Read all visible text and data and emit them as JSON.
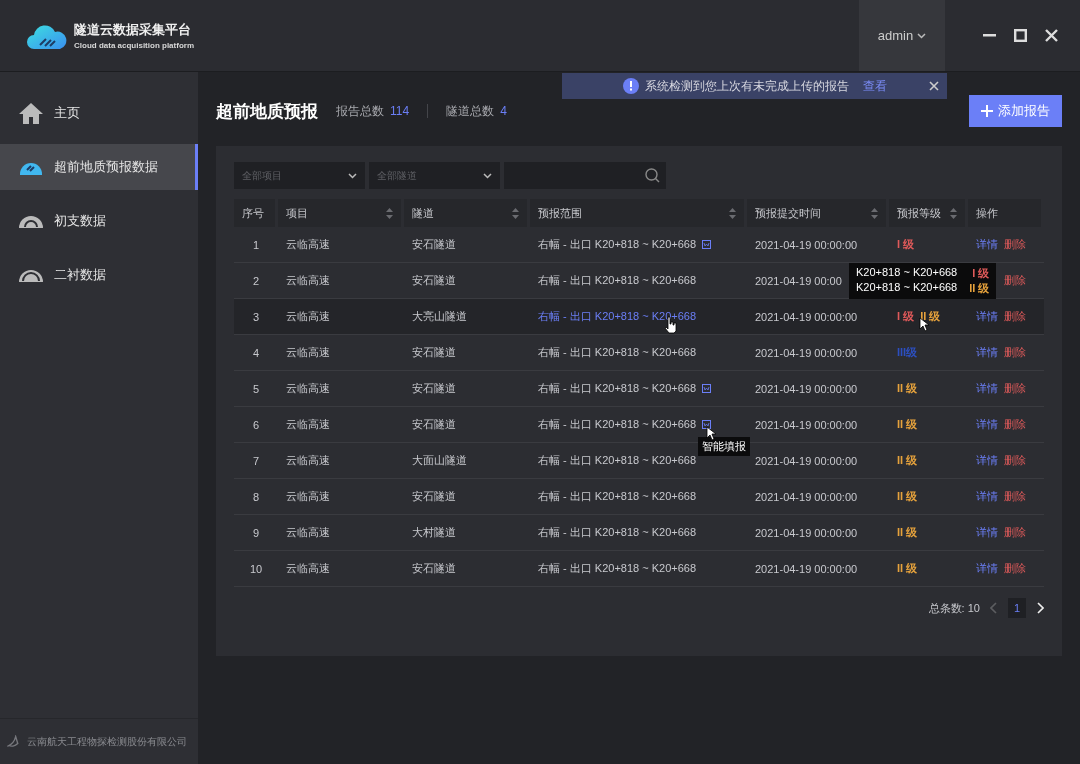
{
  "app": {
    "title": "隧道云数据采集平台",
    "subtitle": "Cloud data acquisition platform"
  },
  "user": {
    "name": "admin"
  },
  "sidebar": {
    "items": [
      {
        "label": "主页",
        "selected": false
      },
      {
        "label": "超前地质预报数据",
        "selected": true
      },
      {
        "label": "初支数据",
        "selected": false
      },
      {
        "label": "二衬数据",
        "selected": false
      }
    ],
    "footer": "云南航天工程物探检测股份有限公司"
  },
  "notice": {
    "text": "系统检测到您上次有未完成上传的报告",
    "link": "查看"
  },
  "page": {
    "title": "超前地质预报",
    "stats": [
      {
        "label": "报告总数",
        "value": "114"
      },
      {
        "label": "隧道总数",
        "value": "4"
      }
    ],
    "add_button": "添加报告"
  },
  "filters": [
    {
      "kind": "select",
      "placeholder": "全部项目"
    },
    {
      "kind": "select",
      "placeholder": "全部隧道"
    },
    {
      "kind": "search"
    }
  ],
  "table": {
    "columns": [
      {
        "label": "序号",
        "sortable": false
      },
      {
        "label": "项目",
        "sortable": true
      },
      {
        "label": "隧道",
        "sortable": true
      },
      {
        "label": "预报范围",
        "sortable": true
      },
      {
        "label": "预报提交时间",
        "sortable": true
      },
      {
        "label": "预报等级",
        "sortable": true
      },
      {
        "label": "操作",
        "sortable": false
      }
    ],
    "rows": [
      {
        "no": "1",
        "project": "云临高速",
        "tunnel": "安石隧道",
        "range": "右幅 - 出口 K20+818 ~ K20+668",
        "attachment": {
          "kind": "word"
        },
        "time": "2021-04-19 00:00:00",
        "levels": [
          {
            "text": "I 级",
            "color": "#e05a5a"
          }
        ],
        "hovered": false,
        "actions": [
          {
            "kind": "detail",
            "label": "详情"
          },
          {
            "kind": "delete",
            "label": "删除"
          }
        ]
      },
      {
        "no": "2",
        "project": "云临高速",
        "tunnel": "安石隧道",
        "range": "右幅 - 出口 K20+818 ~ K20+668",
        "time": "2021-04-19 00:00",
        "hovered": false,
        "actions": [
          {
            "kind": "detail"
          },
          {
            "kind": "delete",
            "label": "删除"
          }
        ]
      },
      {
        "no": "3",
        "project": "云临高速",
        "tunnel": "大亮山隧道",
        "range": "右幅 - 出口 K20+818 ~ K20+668",
        "time": "2021-04-19 00:00:00",
        "levels": [
          {
            "text": "I 级",
            "color": "#e05a5a"
          },
          {
            "text": "II 级",
            "color": "#e6a23c"
          }
        ],
        "hovered": true,
        "actions": [
          {
            "kind": "detail",
            "label": "详情"
          },
          {
            "kind": "delete",
            "label": "删除"
          }
        ],
        "tooltip": [
          {
            "range": "K20+818 ~ K20+668",
            "level": "I 级",
            "color": "#e05a5a"
          },
          {
            "range": "K20+818 ~ K20+668",
            "level": "II 级",
            "color": "#e6a23c"
          }
        ]
      },
      {
        "no": "4",
        "project": "云临高速",
        "tunnel": "安石隧道",
        "range": "右幅 - 出口 K20+818 ~ K20+668",
        "time": "2021-04-19 00:00:00",
        "levels": [
          {
            "text": "III级",
            "color": "#2c4fc0"
          }
        ],
        "hovered": false,
        "actions": [
          {
            "kind": "detail",
            "label": "详情"
          },
          {
            "kind": "delete",
            "label": "删除"
          }
        ]
      },
      {
        "no": "5",
        "project": "云临高速",
        "tunnel": "安石隧道",
        "range": "右幅 - 出口 K20+818 ~ K20+668",
        "attachment": {
          "kind": "word"
        },
        "time": "2021-04-19 00:00:00",
        "levels": [
          {
            "text": "II 级",
            "color": "#e6a23c"
          }
        ],
        "hovered": false,
        "actions": [
          {
            "kind": "detail",
            "label": "详情"
          },
          {
            "kind": "delete",
            "label": "删除"
          }
        ]
      },
      {
        "no": "6",
        "project": "云临高速",
        "tunnel": "安石隧道",
        "range": "右幅 - 出口 K20+818 ~ K20+668",
        "attachment": {
          "kind": "word",
          "tooltip": "智能填报"
        },
        "time": "2021-04-19 00:00:00",
        "levels": [
          {
            "text": "II 级",
            "color": "#e6a23c"
          }
        ],
        "hovered": false,
        "actions": [
          {
            "kind": "detail",
            "label": "详情"
          },
          {
            "kind": "delete",
            "label": "删除"
          }
        ]
      },
      {
        "no": "7",
        "project": "云临高速",
        "tunnel": "大面山隧道",
        "range": "右幅 - 出口 K20+818 ~ K20+668",
        "time": "2021-04-19 00:00:00",
        "levels": [
          {
            "text": "II 级",
            "color": "#e6a23c"
          }
        ],
        "hovered": false,
        "actions": [
          {
            "kind": "detail",
            "label": "详情"
          },
          {
            "kind": "delete",
            "label": "删除"
          }
        ]
      },
      {
        "no": "8",
        "project": "云临高速",
        "tunnel": "安石隧道",
        "range": "右幅 - 出口 K20+818 ~ K20+668",
        "time": "2021-04-19 00:00:00",
        "levels": [
          {
            "text": "II 级",
            "color": "#e6a23c"
          }
        ],
        "hovered": false,
        "actions": [
          {
            "kind": "detail",
            "label": "详情"
          },
          {
            "kind": "delete",
            "label": "删除"
          }
        ]
      },
      {
        "no": "9",
        "project": "云临高速",
        "tunnel": "大村隧道",
        "range": "右幅 - 出口 K20+818 ~ K20+668",
        "time": "2021-04-19 00:00:00",
        "levels": [
          {
            "text": "II 级",
            "color": "#e6a23c"
          }
        ],
        "hovered": false,
        "actions": [
          {
            "kind": "detail",
            "label": "详情"
          },
          {
            "kind": "delete",
            "label": "删除"
          }
        ]
      },
      {
        "no": "10",
        "project": "云临高速",
        "tunnel": "安石隧道",
        "range": "右幅 - 出口 K20+818 ~ K20+668",
        "time": "2021-04-19 00:00:00",
        "levels": [
          {
            "text": "II 级",
            "color": "#e6a23c"
          }
        ],
        "hovered": false,
        "actions": [
          {
            "kind": "detail",
            "label": "详情"
          },
          {
            "kind": "delete",
            "label": "删除"
          }
        ]
      }
    ]
  },
  "pagination": {
    "total": "总条数: 10",
    "pages": [
      {
        "label": "1",
        "selected": true
      }
    ],
    "prev_disabled": true,
    "next_disabled": false
  }
}
